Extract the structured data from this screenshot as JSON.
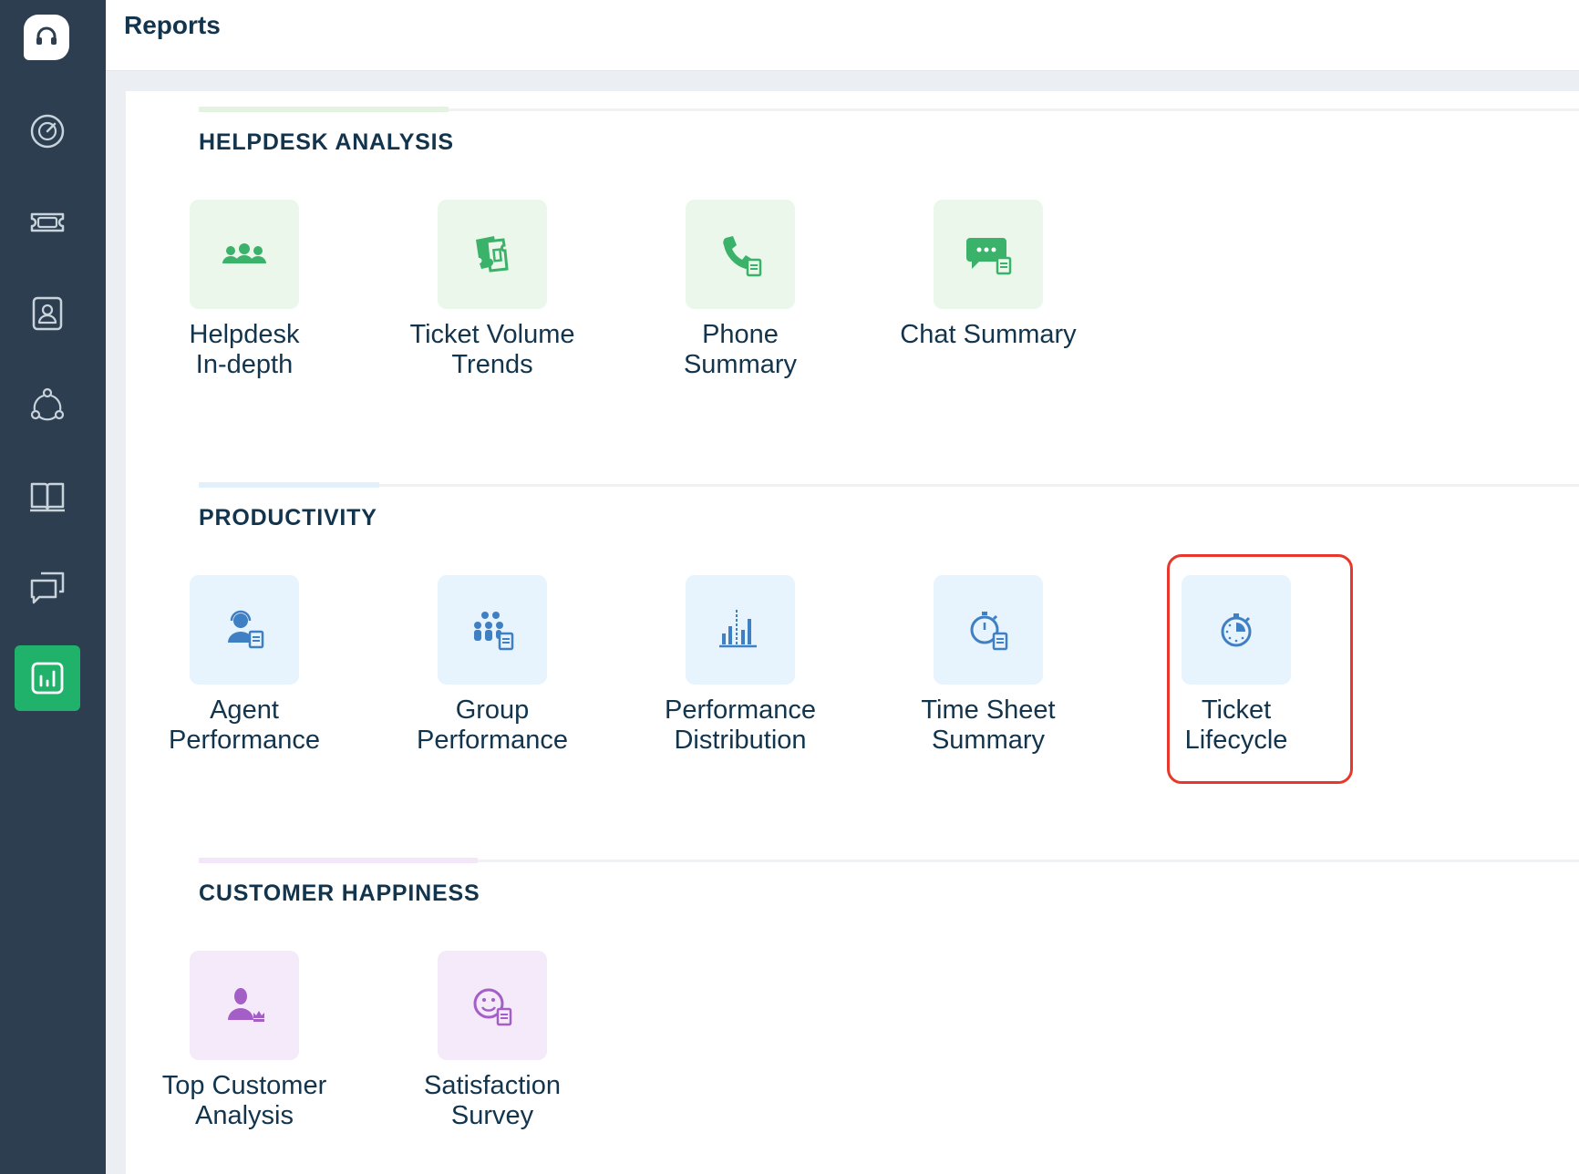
{
  "app": {
    "page_title": "Reports"
  },
  "sidebar": {
    "items": [
      {
        "icon": "dashboard-icon",
        "active": false
      },
      {
        "icon": "ticket-icon",
        "active": false
      },
      {
        "icon": "contacts-icon",
        "active": false
      },
      {
        "icon": "social-icon",
        "active": false
      },
      {
        "icon": "solutions-icon",
        "active": false
      },
      {
        "icon": "forums-icon",
        "active": false
      },
      {
        "icon": "reports-icon",
        "active": true
      }
    ]
  },
  "sections": {
    "helpdesk": {
      "title": "HELPDESK ANALYSIS",
      "accent": "#e3f2e1",
      "tiles": [
        {
          "l1": "Helpdesk",
          "l2": "In-depth",
          "icon": "agents-group-icon"
        },
        {
          "l1": "Ticket Volume",
          "l2": "Trends",
          "icon": "tickets-icon"
        },
        {
          "l1": "Phone",
          "l2": "Summary",
          "icon": "phone-icon"
        },
        {
          "l1": "Chat Summary",
          "l2": "",
          "icon": "chat-icon"
        }
      ]
    },
    "productivity": {
      "title": "PRODUCTIVITY",
      "accent": "#e1f0fb",
      "tiles": [
        {
          "l1": "Agent",
          "l2": "Performance",
          "icon": "agent-icon"
        },
        {
          "l1": "Group",
          "l2": "Performance",
          "icon": "group-icon"
        },
        {
          "l1": "Performance",
          "l2": "Distribution",
          "icon": "bar-chart-icon"
        },
        {
          "l1": "Time Sheet",
          "l2": "Summary",
          "icon": "stopwatch-doc-icon"
        },
        {
          "l1": "Ticket",
          "l2": "Lifecycle",
          "icon": "stopwatch-icon"
        }
      ]
    },
    "happiness": {
      "title": "CUSTOMER HAPPINESS",
      "accent": "#f3e6f8",
      "tiles": [
        {
          "l1": "Top Customer",
          "l2": "Analysis",
          "icon": "top-customer-icon"
        },
        {
          "l1": "Satisfaction",
          "l2": "Survey",
          "icon": "smiley-icon"
        }
      ]
    }
  },
  "colors": {
    "sidebar": "#2c3e50",
    "active": "#20b26b",
    "green_icon": "#3bb26a",
    "blue_icon": "#3f7fc4",
    "purple_icon": "#a35fc6",
    "highlight": "#e8372c"
  }
}
